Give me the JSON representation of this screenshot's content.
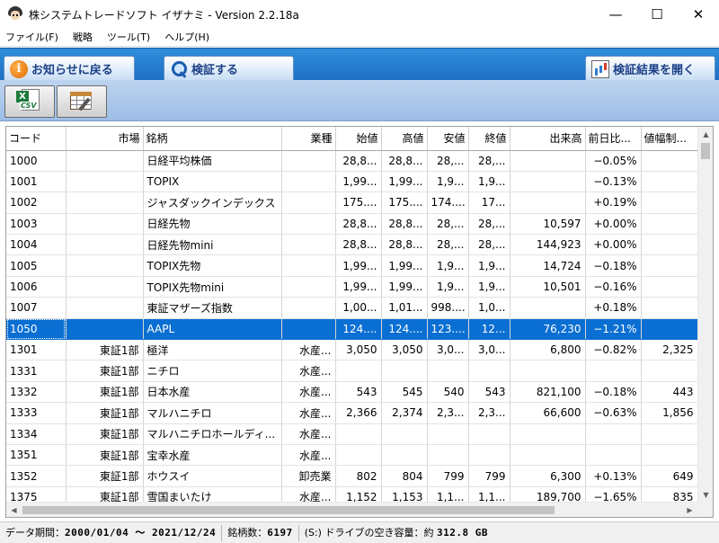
{
  "window": {
    "title": "株システムトレードソフト イザナミ - Version 2.2.18a",
    "controls": {
      "minimize": "—",
      "maximize": "☐",
      "close": "✕"
    }
  },
  "menu": [
    "ファイル(F)",
    "戦略",
    "ツール(T)",
    "ヘルプ(H)"
  ],
  "tabs": {
    "notice": "お知らせに戻る",
    "verify": "検証する",
    "results": "検証結果を開く"
  },
  "toolbar": {
    "csv_label": "CSV",
    "excel_glyph": "X"
  },
  "grid": {
    "columns": [
      "コード",
      "市場",
      "銘柄",
      "業種",
      "始値",
      "高値",
      "安値",
      "終値",
      "出来高",
      "前日比...",
      "値幅制..."
    ],
    "rows": [
      [
        "1000",
        "",
        "日経平均株価",
        "",
        "28,8...",
        "28,8...",
        "28,...",
        "28,...",
        "",
        "−0.05%",
        ""
      ],
      [
        "1001",
        "",
        "TOPIX",
        "",
        "1,99...",
        "1,99...",
        "1,9...",
        "1,9...",
        "",
        "−0.13%",
        ""
      ],
      [
        "1002",
        "",
        "ジャスダックインデックス",
        "",
        "175....",
        "175....",
        "174....",
        "17...",
        "",
        "+0.19%",
        ""
      ],
      [
        "1003",
        "",
        "日経先物",
        "",
        "28,8...",
        "28,8...",
        "28,...",
        "28,...",
        "10,597",
        "+0.00%",
        ""
      ],
      [
        "1004",
        "",
        "日経先物mini",
        "",
        "28,8...",
        "28,8...",
        "28,...",
        "28,...",
        "144,923",
        "+0.00%",
        ""
      ],
      [
        "1005",
        "",
        "TOPIX先物",
        "",
        "1,99...",
        "1,99...",
        "1,9...",
        "1,9...",
        "14,724",
        "−0.18%",
        ""
      ],
      [
        "1006",
        "",
        "TOPIX先物mini",
        "",
        "1,99...",
        "1,99...",
        "1,9...",
        "1,9...",
        "10,501",
        "−0.16%",
        ""
      ],
      [
        "1007",
        "",
        "東証マザーズ指数",
        "",
        "1,00...",
        "1,01...",
        "998....",
        "1,0...",
        "",
        "+0.18%",
        ""
      ],
      [
        "1050",
        "",
        "AAPL",
        "",
        "124....",
        "124....",
        "123....",
        "12...",
        "76,230",
        "−1.21%",
        ""
      ],
      [
        "1301",
        "東証1部",
        "極洋",
        "水産...",
        "3,050",
        "3,050",
        "3,0...",
        "3,0...",
        "6,800",
        "−0.82%",
        "2,325"
      ],
      [
        "1331",
        "東証1部",
        "ニチロ",
        "水産...",
        "",
        "",
        "",
        "",
        "",
        "",
        ""
      ],
      [
        "1332",
        "東証1部",
        "日本水産",
        "水産...",
        "543",
        "545",
        "540",
        "543",
        "821,100",
        "−0.18%",
        "443"
      ],
      [
        "1333",
        "東証1部",
        "マルハニチロ",
        "水産...",
        "2,366",
        "2,374",
        "2,3...",
        "2,3...",
        "66,600",
        "−0.63%",
        "1,856"
      ],
      [
        "1334",
        "東証1部",
        "マルハニチロホールディ...",
        "水産...",
        "",
        "",
        "",
        "",
        "",
        "",
        ""
      ],
      [
        "1351",
        "東証1部",
        "宝幸水産",
        "水産...",
        "",
        "",
        "",
        "",
        "",
        "",
        ""
      ],
      [
        "1352",
        "東証1部",
        "ホウスイ",
        "卸売業",
        "802",
        "804",
        "799",
        "799",
        "6,300",
        "+0.13%",
        "649"
      ],
      [
        "1375",
        "東証1部",
        "雪国まいたけ",
        "水産...",
        "1,152",
        "1,153",
        "1,1...",
        "1,1...",
        "189,700",
        "−1.65%",
        "835"
      ]
    ],
    "selected_row": 8
  },
  "status": {
    "period_label": "データ期間：",
    "period_value": "2000/01/04 〜 2021/12/24",
    "count_label": "銘柄数：",
    "count_value": "6197",
    "drive_label": "(S:) ドライブの空き容量：約",
    "drive_value": "312.8 GB"
  },
  "colors": {
    "tab_bar": "#1f6fc3",
    "toolbar": "#a9c6ea",
    "selection": "#0a6fd2"
  }
}
